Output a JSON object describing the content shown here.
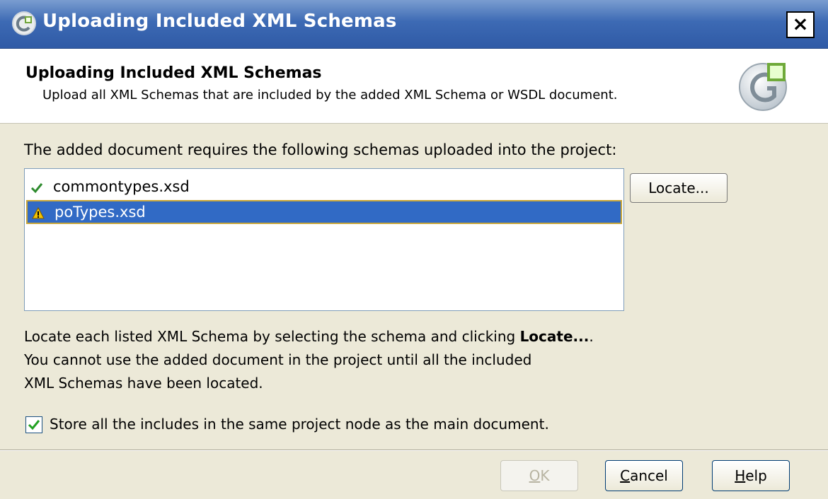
{
  "window": {
    "title": "Uploading Included XML Schemas",
    "close_label": "×"
  },
  "header": {
    "title": "Uploading Included XML Schemas",
    "subtitle": "Upload all XML Schemas that are included by the added XML Schema or WSDL document."
  },
  "prompt": "The added document requires the following schemas uploaded into the project:",
  "schemas": [
    {
      "label": "commontypes.xsd",
      "status_icon": "checkmark-icon",
      "selected": false
    },
    {
      "label": "poTypes.xsd",
      "status_icon": "warning-icon",
      "selected": true
    }
  ],
  "locate_button": "Locate...",
  "instructions": {
    "line1_prefix": "Locate each listed XML Schema by selecting the schema and clicking ",
    "line1_bold": "Locate...",
    "line1_suffix": ".",
    "line2": "You cannot use the added document in the project until all the included",
    "line3": "XML Schemas have been located."
  },
  "store_checkbox": {
    "checked": true,
    "label": "Store all the includes in the same project node as the main document."
  },
  "buttons": {
    "ok": {
      "mnemonic": "O",
      "rest": "K",
      "enabled": false
    },
    "cancel": {
      "mnemonic": "C",
      "rest": "ancel",
      "enabled": true
    },
    "help": {
      "mnemonic": "H",
      "rest": "elp",
      "enabled": true
    }
  },
  "colors": {
    "title_bar": "#2f5aa6",
    "selection": "#316ac5",
    "selection_border": "#c8a63a",
    "dialog_bg": "#ece9d8",
    "check_green": "#2e8b2e",
    "warning_yellow": "#f2c200"
  }
}
